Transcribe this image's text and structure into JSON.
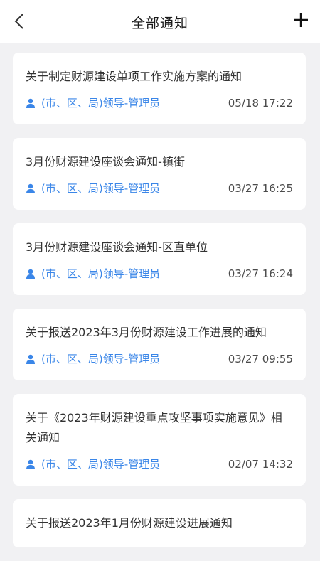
{
  "header": {
    "title": "全部通知",
    "back_icon": "chevron-left-icon",
    "add_icon": "plus-icon"
  },
  "colors": {
    "accent": "#3a86e8",
    "background": "#f1f1f3",
    "card": "#ffffff"
  },
  "notices": [
    {
      "title": "关于制定财源建设单项工作实施方案的通知",
      "author": "(市、区、局)领导-管理员",
      "time": "05/18 17:22"
    },
    {
      "title": "3月份财源建设座谈会通知-镇街",
      "author": "(市、区、局)领导-管理员",
      "time": "03/27 16:25"
    },
    {
      "title": "3月份财源建设座谈会通知-区直单位",
      "author": "(市、区、局)领导-管理员",
      "time": "03/27 16:24"
    },
    {
      "title": "关于报送2023年3月份财源建设工作进展的通知",
      "author": "(市、区、局)领导-管理员",
      "time": "03/27 09:55"
    },
    {
      "title": "关于《2023年财源建设重点攻坚事项实施意见》相关通知",
      "author": "(市、区、局)领导-管理员",
      "time": "02/07 14:32"
    },
    {
      "title": "关于报送2023年1月份财源建设进展通知",
      "author": "",
      "time": ""
    }
  ]
}
